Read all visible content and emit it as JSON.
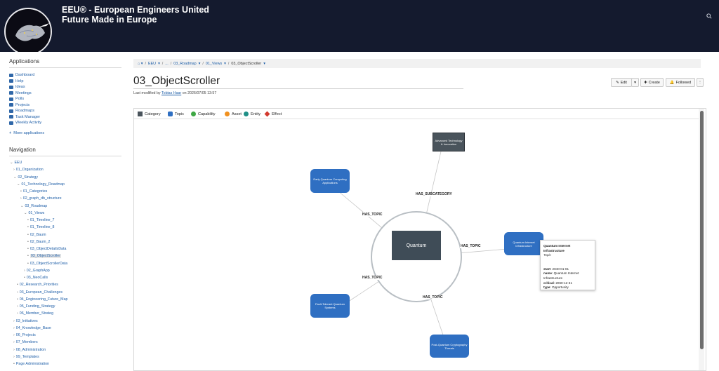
{
  "header": {
    "title_line1": "EEU® - European Engineers United",
    "title_line2": "Future Made in Europe",
    "search_icon": "search-icon"
  },
  "sidebar": {
    "applications_heading": "Applications",
    "applications": [
      {
        "label": "Dashboard",
        "icon": "dashboard-icon"
      },
      {
        "label": "Help",
        "icon": "help-icon"
      },
      {
        "label": "Ideas",
        "icon": "lightbulb-icon"
      },
      {
        "label": "Meetings",
        "icon": "calendar-icon"
      },
      {
        "label": "Polls",
        "icon": "poll-icon"
      },
      {
        "label": "Projects",
        "icon": "chart-icon"
      },
      {
        "label": "Roadmaps",
        "icon": "sitemap-icon"
      },
      {
        "label": "Task Manager",
        "icon": "tasks-icon"
      },
      {
        "label": "Weekly Activity",
        "icon": "activity-icon"
      }
    ],
    "more_apps": "More applications",
    "navigation_heading": "Navigation",
    "tree": [
      {
        "label": "EEU",
        "arrow": "⌄"
      },
      {
        "label": "01_Organization",
        "arrow": "›"
      },
      {
        "label": "02_Strategy",
        "arrow": "⌄"
      },
      {
        "label": "01_Technology_Roadmap",
        "arrow": "⌄"
      },
      {
        "label": "01_Categories",
        "arrow": "•"
      },
      {
        "label": "02_graph_db_structure",
        "arrow": "›"
      },
      {
        "label": "03_Roadmap",
        "arrow": "⌄"
      },
      {
        "label": "01_Views",
        "arrow": "⌄"
      },
      {
        "label": "01_Timeline_7",
        "arrow": "•"
      },
      {
        "label": "01_Timeline_8",
        "arrow": "•"
      },
      {
        "label": "02_Baum",
        "arrow": "•"
      },
      {
        "label": "02_Baum_2",
        "arrow": "•"
      },
      {
        "label": "03_ObjectDetailsData",
        "arrow": "•"
      },
      {
        "label": "03_ObjectScroller",
        "arrow": "•"
      },
      {
        "label": "03_ObjectScrollerData",
        "arrow": "•"
      },
      {
        "label": "02_GraphApp",
        "arrow": "›"
      },
      {
        "label": "03_NeoCalls",
        "arrow": "•"
      },
      {
        "label": "02_Research_Priorities",
        "arrow": "•"
      },
      {
        "label": "03_European_Challenges",
        "arrow": "›"
      },
      {
        "label": "04_Engineering_Future_Map",
        "arrow": "•"
      },
      {
        "label": "05_Funding_Strategy",
        "arrow": "›"
      },
      {
        "label": "06_Member_Strateg",
        "arrow": "›"
      },
      {
        "label": "03_Initiatives",
        "arrow": "›"
      },
      {
        "label": "04_Knowledge_Base",
        "arrow": "›"
      },
      {
        "label": "06_Projects",
        "arrow": "›"
      },
      {
        "label": "07_Members",
        "arrow": "›"
      },
      {
        "label": "08_Administration",
        "arrow": "›"
      },
      {
        "label": "99_Templates",
        "arrow": "›"
      },
      {
        "label": "Page Administration",
        "arrow": "•"
      }
    ]
  },
  "breadcrumb": [
    "EEU",
    "...",
    "03_Roadmap",
    "01_Views",
    "03_ObjectScroller"
  ],
  "page": {
    "title": "03_ObjectScroller",
    "modified_prefix": "Last modified by",
    "modified_user": "Tobias Haar",
    "modified_suffix": "on 2026/07/05 13:57"
  },
  "toolbar": {
    "edit": "Edit",
    "create": "Create",
    "followed": "Followed"
  },
  "legend": [
    {
      "label": "Category",
      "color": "#4a545c",
      "shape": "square"
    },
    {
      "label": "Topic",
      "color": "#2f6fc2",
      "shape": "rounded"
    },
    {
      "label": "Capability",
      "color": "#3fa845",
      "shape": "circle"
    },
    {
      "label": "Asset",
      "color": "#f0901e",
      "shape": "circle"
    },
    {
      "label": "Entity",
      "color": "#1f8f86",
      "shape": "circle"
    },
    {
      "label": "Effect",
      "color": "#d23a2e",
      "shape": "diamond"
    }
  ],
  "graph": {
    "center": "Quantum",
    "nodes": {
      "advanced": "Advanced Technology & Innovation",
      "early": "Early Quantum Computing Applications",
      "internet": "Quantum Internet Infrastructure",
      "fault": "Fault-Tolerant Quantum Systems",
      "postq": "Post-Quantum Cryptography Threats"
    },
    "edges": {
      "has_subcategory": "HAS_SUBCATEGORY",
      "has_topic_1": "HAS_TOPIC",
      "has_topic_2": "HAS_TOPIC",
      "has_topic_3": "HAS_TOPIC",
      "has_topic_4": "HAS_TOPIC"
    }
  },
  "tooltip": {
    "title": "Quantum Internet Infrastructure",
    "type": "Topic",
    "start_key": "start",
    "start_val": "2040-01-01",
    "name_key": "name",
    "name_val": "Quantum Internet Infrastructure",
    "critical_key": "critical",
    "critical_val": "2060-12-31",
    "type_key": "type",
    "type_val": "Opportunity"
  }
}
